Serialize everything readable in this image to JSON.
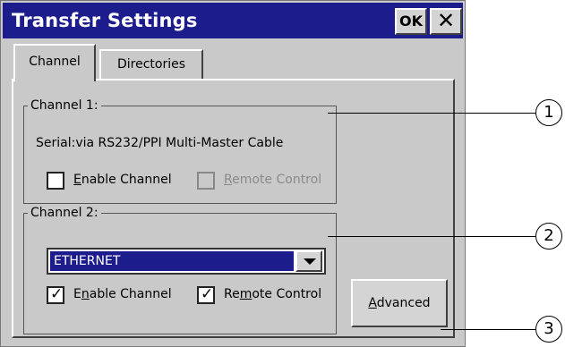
{
  "dialog": {
    "title": "Transfer Settings",
    "ok_label": "OK",
    "close_label": "✕"
  },
  "tabs": [
    {
      "label": "Channel"
    },
    {
      "label": "Directories"
    }
  ],
  "channel1": {
    "legend": "Channel 1:",
    "description": "Serial:via RS232/PPI Multi-Master Cable",
    "enable": {
      "pre": "",
      "accel": "E",
      "post": "nable Channel",
      "checked": false
    },
    "remote": {
      "pre": "",
      "accel": "R",
      "post": "emote Control",
      "checked": false,
      "disabled": true
    }
  },
  "channel2": {
    "legend": "Channel 2:",
    "protocol": "ETHERNET",
    "enable": {
      "pre": "E",
      "accel": "n",
      "post": "able Channel",
      "checked": true
    },
    "remote": {
      "pre": "Re",
      "accel": "m",
      "post": "ote Control",
      "checked": true
    }
  },
  "advanced": {
    "pre": "",
    "accel": "A",
    "post": "dvanced"
  },
  "callouts": [
    "1",
    "2",
    "3"
  ]
}
